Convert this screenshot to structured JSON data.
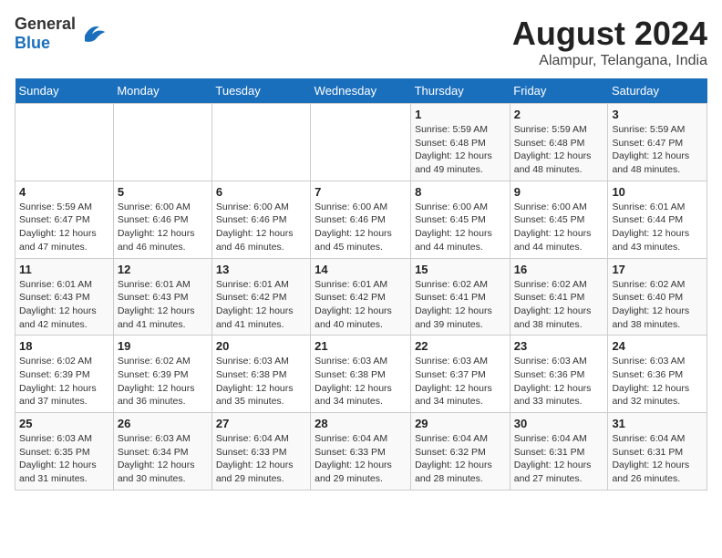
{
  "header": {
    "logo_general": "General",
    "logo_blue": "Blue",
    "month_year": "August 2024",
    "location": "Alampur, Telangana, India"
  },
  "weekdays": [
    "Sunday",
    "Monday",
    "Tuesday",
    "Wednesday",
    "Thursday",
    "Friday",
    "Saturday"
  ],
  "weeks": [
    [
      {
        "day": "",
        "text": ""
      },
      {
        "day": "",
        "text": ""
      },
      {
        "day": "",
        "text": ""
      },
      {
        "day": "",
        "text": ""
      },
      {
        "day": "1",
        "text": "Sunrise: 5:59 AM\nSunset: 6:48 PM\nDaylight: 12 hours\nand 49 minutes."
      },
      {
        "day": "2",
        "text": "Sunrise: 5:59 AM\nSunset: 6:48 PM\nDaylight: 12 hours\nand 48 minutes."
      },
      {
        "day": "3",
        "text": "Sunrise: 5:59 AM\nSunset: 6:47 PM\nDaylight: 12 hours\nand 48 minutes."
      }
    ],
    [
      {
        "day": "4",
        "text": "Sunrise: 5:59 AM\nSunset: 6:47 PM\nDaylight: 12 hours\nand 47 minutes."
      },
      {
        "day": "5",
        "text": "Sunrise: 6:00 AM\nSunset: 6:46 PM\nDaylight: 12 hours\nand 46 minutes."
      },
      {
        "day": "6",
        "text": "Sunrise: 6:00 AM\nSunset: 6:46 PM\nDaylight: 12 hours\nand 46 minutes."
      },
      {
        "day": "7",
        "text": "Sunrise: 6:00 AM\nSunset: 6:46 PM\nDaylight: 12 hours\nand 45 minutes."
      },
      {
        "day": "8",
        "text": "Sunrise: 6:00 AM\nSunset: 6:45 PM\nDaylight: 12 hours\nand 44 minutes."
      },
      {
        "day": "9",
        "text": "Sunrise: 6:00 AM\nSunset: 6:45 PM\nDaylight: 12 hours\nand 44 minutes."
      },
      {
        "day": "10",
        "text": "Sunrise: 6:01 AM\nSunset: 6:44 PM\nDaylight: 12 hours\nand 43 minutes."
      }
    ],
    [
      {
        "day": "11",
        "text": "Sunrise: 6:01 AM\nSunset: 6:43 PM\nDaylight: 12 hours\nand 42 minutes."
      },
      {
        "day": "12",
        "text": "Sunrise: 6:01 AM\nSunset: 6:43 PM\nDaylight: 12 hours\nand 41 minutes."
      },
      {
        "day": "13",
        "text": "Sunrise: 6:01 AM\nSunset: 6:42 PM\nDaylight: 12 hours\nand 41 minutes."
      },
      {
        "day": "14",
        "text": "Sunrise: 6:01 AM\nSunset: 6:42 PM\nDaylight: 12 hours\nand 40 minutes."
      },
      {
        "day": "15",
        "text": "Sunrise: 6:02 AM\nSunset: 6:41 PM\nDaylight: 12 hours\nand 39 minutes."
      },
      {
        "day": "16",
        "text": "Sunrise: 6:02 AM\nSunset: 6:41 PM\nDaylight: 12 hours\nand 38 minutes."
      },
      {
        "day": "17",
        "text": "Sunrise: 6:02 AM\nSunset: 6:40 PM\nDaylight: 12 hours\nand 38 minutes."
      }
    ],
    [
      {
        "day": "18",
        "text": "Sunrise: 6:02 AM\nSunset: 6:39 PM\nDaylight: 12 hours\nand 37 minutes."
      },
      {
        "day": "19",
        "text": "Sunrise: 6:02 AM\nSunset: 6:39 PM\nDaylight: 12 hours\nand 36 minutes."
      },
      {
        "day": "20",
        "text": "Sunrise: 6:03 AM\nSunset: 6:38 PM\nDaylight: 12 hours\nand 35 minutes."
      },
      {
        "day": "21",
        "text": "Sunrise: 6:03 AM\nSunset: 6:38 PM\nDaylight: 12 hours\nand 34 minutes."
      },
      {
        "day": "22",
        "text": "Sunrise: 6:03 AM\nSunset: 6:37 PM\nDaylight: 12 hours\nand 34 minutes."
      },
      {
        "day": "23",
        "text": "Sunrise: 6:03 AM\nSunset: 6:36 PM\nDaylight: 12 hours\nand 33 minutes."
      },
      {
        "day": "24",
        "text": "Sunrise: 6:03 AM\nSunset: 6:36 PM\nDaylight: 12 hours\nand 32 minutes."
      }
    ],
    [
      {
        "day": "25",
        "text": "Sunrise: 6:03 AM\nSunset: 6:35 PM\nDaylight: 12 hours\nand 31 minutes."
      },
      {
        "day": "26",
        "text": "Sunrise: 6:03 AM\nSunset: 6:34 PM\nDaylight: 12 hours\nand 30 minutes."
      },
      {
        "day": "27",
        "text": "Sunrise: 6:04 AM\nSunset: 6:33 PM\nDaylight: 12 hours\nand 29 minutes."
      },
      {
        "day": "28",
        "text": "Sunrise: 6:04 AM\nSunset: 6:33 PM\nDaylight: 12 hours\nand 29 minutes."
      },
      {
        "day": "29",
        "text": "Sunrise: 6:04 AM\nSunset: 6:32 PM\nDaylight: 12 hours\nand 28 minutes."
      },
      {
        "day": "30",
        "text": "Sunrise: 6:04 AM\nSunset: 6:31 PM\nDaylight: 12 hours\nand 27 minutes."
      },
      {
        "day": "31",
        "text": "Sunrise: 6:04 AM\nSunset: 6:31 PM\nDaylight: 12 hours\nand 26 minutes."
      }
    ]
  ]
}
